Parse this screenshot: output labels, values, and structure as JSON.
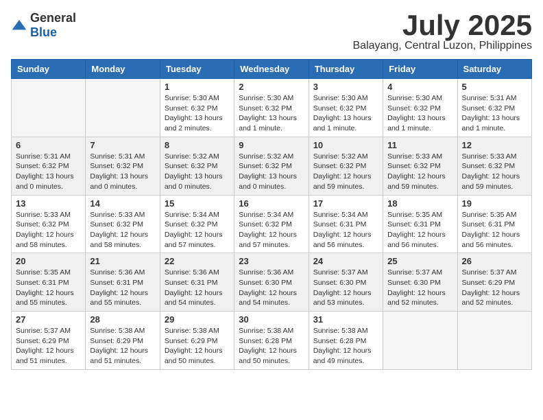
{
  "logo": {
    "general": "General",
    "blue": "Blue"
  },
  "title": {
    "month_year": "July 2025",
    "location": "Balayang, Central Luzon, Philippines"
  },
  "weekdays": [
    "Sunday",
    "Monday",
    "Tuesday",
    "Wednesday",
    "Thursday",
    "Friday",
    "Saturday"
  ],
  "weeks": [
    [
      {
        "day": "",
        "info": ""
      },
      {
        "day": "",
        "info": ""
      },
      {
        "day": "1",
        "info": "Sunrise: 5:30 AM\nSunset: 6:32 PM\nDaylight: 13 hours\nand 2 minutes."
      },
      {
        "day": "2",
        "info": "Sunrise: 5:30 AM\nSunset: 6:32 PM\nDaylight: 13 hours\nand 1 minute."
      },
      {
        "day": "3",
        "info": "Sunrise: 5:30 AM\nSunset: 6:32 PM\nDaylight: 13 hours\nand 1 minute."
      },
      {
        "day": "4",
        "info": "Sunrise: 5:30 AM\nSunset: 6:32 PM\nDaylight: 13 hours\nand 1 minute."
      },
      {
        "day": "5",
        "info": "Sunrise: 5:31 AM\nSunset: 6:32 PM\nDaylight: 13 hours\nand 1 minute."
      }
    ],
    [
      {
        "day": "6",
        "info": "Sunrise: 5:31 AM\nSunset: 6:32 PM\nDaylight: 13 hours\nand 0 minutes."
      },
      {
        "day": "7",
        "info": "Sunrise: 5:31 AM\nSunset: 6:32 PM\nDaylight: 13 hours\nand 0 minutes."
      },
      {
        "day": "8",
        "info": "Sunrise: 5:32 AM\nSunset: 6:32 PM\nDaylight: 13 hours\nand 0 minutes."
      },
      {
        "day": "9",
        "info": "Sunrise: 5:32 AM\nSunset: 6:32 PM\nDaylight: 13 hours\nand 0 minutes."
      },
      {
        "day": "10",
        "info": "Sunrise: 5:32 AM\nSunset: 6:32 PM\nDaylight: 12 hours\nand 59 minutes."
      },
      {
        "day": "11",
        "info": "Sunrise: 5:33 AM\nSunset: 6:32 PM\nDaylight: 12 hours\nand 59 minutes."
      },
      {
        "day": "12",
        "info": "Sunrise: 5:33 AM\nSunset: 6:32 PM\nDaylight: 12 hours\nand 59 minutes."
      }
    ],
    [
      {
        "day": "13",
        "info": "Sunrise: 5:33 AM\nSunset: 6:32 PM\nDaylight: 12 hours\nand 58 minutes."
      },
      {
        "day": "14",
        "info": "Sunrise: 5:33 AM\nSunset: 6:32 PM\nDaylight: 12 hours\nand 58 minutes."
      },
      {
        "day": "15",
        "info": "Sunrise: 5:34 AM\nSunset: 6:32 PM\nDaylight: 12 hours\nand 57 minutes."
      },
      {
        "day": "16",
        "info": "Sunrise: 5:34 AM\nSunset: 6:32 PM\nDaylight: 12 hours\nand 57 minutes."
      },
      {
        "day": "17",
        "info": "Sunrise: 5:34 AM\nSunset: 6:31 PM\nDaylight: 12 hours\nand 56 minutes."
      },
      {
        "day": "18",
        "info": "Sunrise: 5:35 AM\nSunset: 6:31 PM\nDaylight: 12 hours\nand 56 minutes."
      },
      {
        "day": "19",
        "info": "Sunrise: 5:35 AM\nSunset: 6:31 PM\nDaylight: 12 hours\nand 56 minutes."
      }
    ],
    [
      {
        "day": "20",
        "info": "Sunrise: 5:35 AM\nSunset: 6:31 PM\nDaylight: 12 hours\nand 55 minutes."
      },
      {
        "day": "21",
        "info": "Sunrise: 5:36 AM\nSunset: 6:31 PM\nDaylight: 12 hours\nand 55 minutes."
      },
      {
        "day": "22",
        "info": "Sunrise: 5:36 AM\nSunset: 6:31 PM\nDaylight: 12 hours\nand 54 minutes."
      },
      {
        "day": "23",
        "info": "Sunrise: 5:36 AM\nSunset: 6:30 PM\nDaylight: 12 hours\nand 54 minutes."
      },
      {
        "day": "24",
        "info": "Sunrise: 5:37 AM\nSunset: 6:30 PM\nDaylight: 12 hours\nand 53 minutes."
      },
      {
        "day": "25",
        "info": "Sunrise: 5:37 AM\nSunset: 6:30 PM\nDaylight: 12 hours\nand 52 minutes."
      },
      {
        "day": "26",
        "info": "Sunrise: 5:37 AM\nSunset: 6:29 PM\nDaylight: 12 hours\nand 52 minutes."
      }
    ],
    [
      {
        "day": "27",
        "info": "Sunrise: 5:37 AM\nSunset: 6:29 PM\nDaylight: 12 hours\nand 51 minutes."
      },
      {
        "day": "28",
        "info": "Sunrise: 5:38 AM\nSunset: 6:29 PM\nDaylight: 12 hours\nand 51 minutes."
      },
      {
        "day": "29",
        "info": "Sunrise: 5:38 AM\nSunset: 6:29 PM\nDaylight: 12 hours\nand 50 minutes."
      },
      {
        "day": "30",
        "info": "Sunrise: 5:38 AM\nSunset: 6:28 PM\nDaylight: 12 hours\nand 50 minutes."
      },
      {
        "day": "31",
        "info": "Sunrise: 5:38 AM\nSunset: 6:28 PM\nDaylight: 12 hours\nand 49 minutes."
      },
      {
        "day": "",
        "info": ""
      },
      {
        "day": "",
        "info": ""
      }
    ]
  ]
}
